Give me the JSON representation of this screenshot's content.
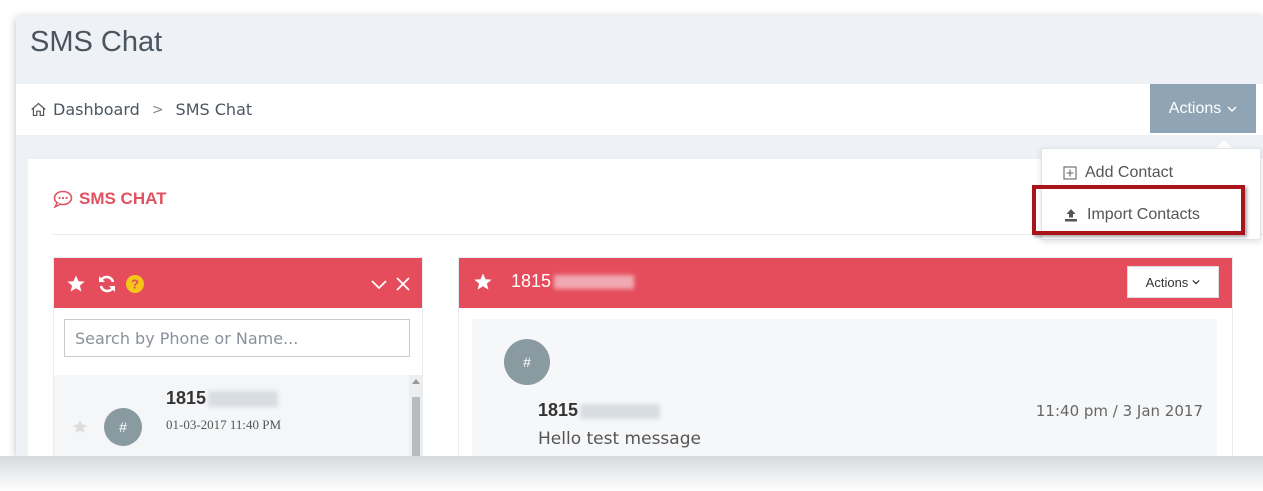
{
  "page": {
    "title": "SMS Chat"
  },
  "breadcrumb": {
    "home_label": "Dashboard",
    "separator": ">",
    "current": "SMS Chat"
  },
  "header_actions": {
    "label": "Actions"
  },
  "dropdown": {
    "items": [
      {
        "label": "Add Contact",
        "icon": "plus-square-icon"
      },
      {
        "label": "Import Contacts",
        "icon": "upload-icon"
      }
    ]
  },
  "portlet": {
    "title": "SMS CHAT",
    "icon": "chat-bubble-icon"
  },
  "chat_list": {
    "search_placeholder": "Search by Phone or Name...",
    "contacts": [
      {
        "name": "1815",
        "date": "01-03-2017 11:40 PM",
        "avatar": "#"
      }
    ]
  },
  "conversation": {
    "title": "1815",
    "actions_label": "Actions",
    "messages": [
      {
        "avatar": "#",
        "sender": "1815",
        "text": "Hello test message",
        "time": "11:40 pm / 3 Jan 2017"
      }
    ]
  },
  "colors": {
    "accent_red": "#e54d5d",
    "actions_bg": "#8fa4b4",
    "highlight_border": "#a8141a"
  }
}
